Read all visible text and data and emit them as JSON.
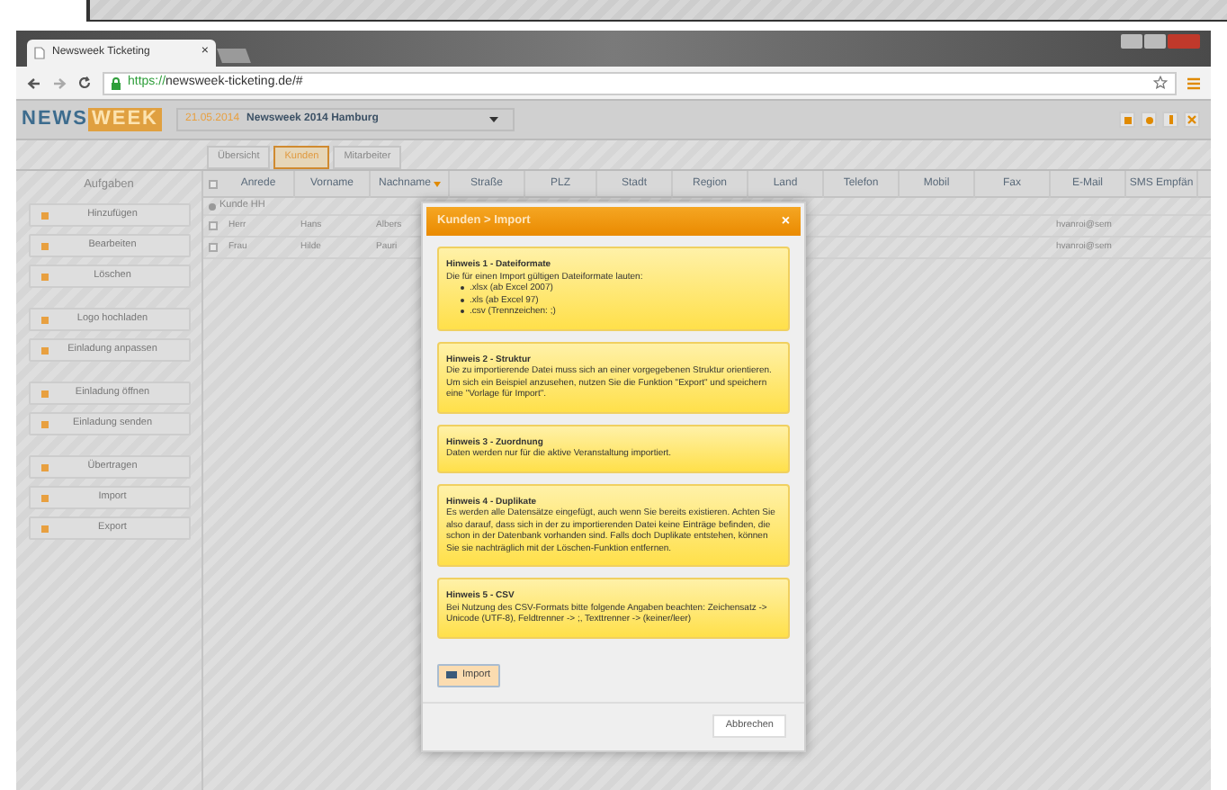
{
  "browser": {
    "tab_title": "Newsweek Ticketing",
    "tab_close": "×",
    "url_scheme": "https://",
    "url_rest": "newsweek-ticketing.de/#"
  },
  "header": {
    "logo_left": "NEWS",
    "logo_right": "WEEK",
    "date": "21.05.2014",
    "event": "Newsweek 2014 Hamburg"
  },
  "tabs": [
    {
      "label": "Übersicht",
      "selected": false
    },
    {
      "label": "Kunden",
      "selected": true
    },
    {
      "label": "Mitarbeiter",
      "selected": false
    }
  ],
  "sidebar": {
    "title": "Aufgaben",
    "groups": [
      [
        "Hinzufügen",
        "Bearbeiten",
        "Löschen"
      ],
      [
        "Logo hochladen",
        "Einladung anpassen"
      ],
      [
        "Einladung öffnen",
        "Einladung senden"
      ],
      [
        "Übertragen",
        "Import",
        "Export"
      ]
    ]
  },
  "table": {
    "columns": [
      {
        "label": "Anrede",
        "sorted": false
      },
      {
        "label": "Vorname",
        "sorted": false
      },
      {
        "label": "Nachname",
        "sorted": true
      },
      {
        "label": "Straße",
        "sorted": false
      },
      {
        "label": "PLZ",
        "sorted": false
      },
      {
        "label": "Stadt",
        "sorted": false
      },
      {
        "label": "Region",
        "sorted": false
      },
      {
        "label": "Land",
        "sorted": false
      },
      {
        "label": "Telefon",
        "sorted": false
      },
      {
        "label": "Mobil",
        "sorted": false
      },
      {
        "label": "Fax",
        "sorted": false
      },
      {
        "label": "E-Mail",
        "sorted": false
      },
      {
        "label": "SMS Empfän",
        "sorted": false
      }
    ],
    "select_all_checked": false,
    "group": "Kunde HH",
    "rows": [
      {
        "checked": false,
        "cells": [
          "Herr",
          "Hans",
          "Albers",
          "",
          "",
          "",
          "",
          "",
          "",
          "",
          "",
          "hvanroi@sem",
          ""
        ]
      },
      {
        "checked": false,
        "cells": [
          "Frau",
          "Hilde",
          "Pauri",
          "",
          "",
          "",
          "",
          "",
          "",
          "",
          "",
          "hvanroi@sem",
          ""
        ]
      }
    ]
  },
  "dialog": {
    "title": "Kunden > Import",
    "close": "×",
    "hints": [
      {
        "title": "Hinweis 1 - Dateiformate",
        "text": "Die für einen Import gültigen Dateiformate lauten:",
        "bullets": [
          ".xlsx (ab Excel 2007)",
          ".xls (ab Excel 97)",
          ".csv (Trennzeichen: ;)"
        ]
      },
      {
        "title": "Hinweis 2 - Struktur",
        "text": "Die zu importierende Datei muss sich an einer vorgegebenen Struktur orientieren. Um sich ein Beispiel anzusehen, nutzen Sie die Funktion \"Export\" und speichern eine \"Vorlage für Import\"."
      },
      {
        "title": "Hinweis 3 - Zuordnung",
        "text": "Daten werden nur für die aktive Veranstaltung importiert."
      },
      {
        "title": "Hinweis 4 - Duplikate",
        "text": "Es werden alle Datensätze eingefügt, auch wenn Sie bereits existieren. Achten Sie also darauf, dass sich in der zu importierenden Datei keine Einträge befinden, die schon in der Datenbank vorhanden sind. Falls doch Duplikate entstehen, können Sie sie nachträglich mit der Löschen-Funktion entfernen."
      },
      {
        "title": "Hinweis 5 - CSV",
        "text": "Bei Nutzung des CSV-Formats bitte folgende Angaben beachten: Zeichensatz -> Unicode (UTF-8), Feldtrenner -> ;, Texttrenner -> (keiner/leer)"
      }
    ],
    "import_button": "Import",
    "cancel_button": "Abbrechen"
  }
}
